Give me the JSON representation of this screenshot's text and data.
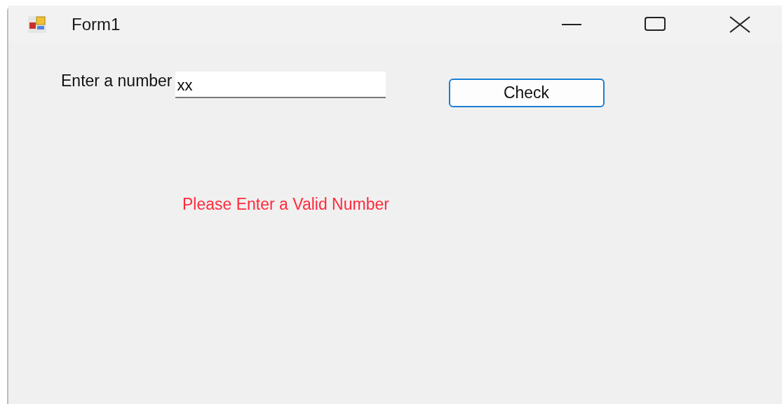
{
  "window": {
    "title": "Form1"
  },
  "form": {
    "label": "Enter a number",
    "input": {
      "value": "xx"
    },
    "button": "Check",
    "message": "Please Enter a Valid Number"
  }
}
